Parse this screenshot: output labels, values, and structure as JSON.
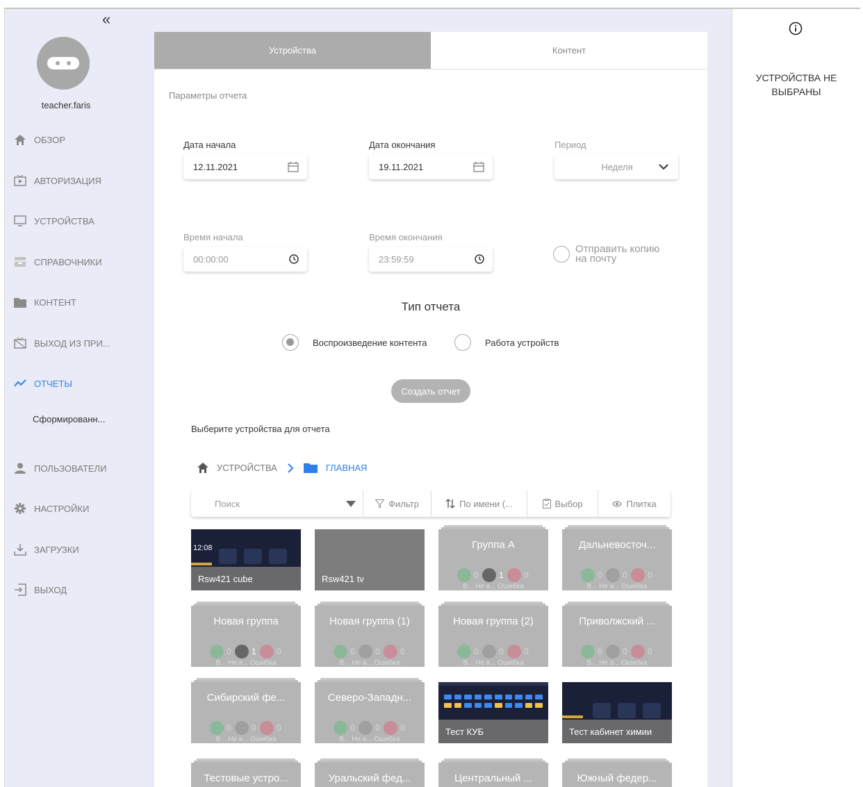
{
  "sidebar": {
    "collapse_glyph": "«",
    "username": "teacher.faris",
    "items": [
      {
        "label": "ОБЗОР",
        "icon": "home-icon"
      },
      {
        "label": "АВТОРИЗАЦИЯ",
        "icon": "tv-play-icon"
      },
      {
        "label": "УСТРОЙСТВА",
        "icon": "monitor-icon"
      },
      {
        "label": "СПРАВОЧНИКИ",
        "icon": "drawer-icon"
      },
      {
        "label": "КОНТЕНТ",
        "icon": "folder-icon"
      },
      {
        "label": "ВЫХОД ИЗ ПРИ...",
        "icon": "tv-off-icon"
      },
      {
        "label": "ОТЧЕТЫ",
        "icon": "chart-line-icon",
        "active": true
      },
      {
        "label": "ПОЛЬЗОВАТЕЛИ",
        "icon": "user-icon"
      },
      {
        "label": "НАСТРОЙКИ",
        "icon": "gear-icon"
      },
      {
        "label": "ЗАГРУЗКИ",
        "icon": "download-icon"
      },
      {
        "label": "ВЫХОД",
        "icon": "logout-icon"
      }
    ],
    "sub_item": "Сформированн..."
  },
  "tabs": [
    {
      "label": "Устройства",
      "active": true
    },
    {
      "label": "Контент",
      "active": false
    }
  ],
  "params_title": "Параметры отчета",
  "form": {
    "start_date_label": "Дата начала",
    "start_date_value": "12.11.2021",
    "end_date_label": "Дата окончания",
    "end_date_value": "19.11.2021",
    "period_label": "Период",
    "period_value": "Неделя",
    "start_time_label": "Время начала",
    "start_time_value": "00:00:00",
    "end_time_label": "Время окончания",
    "end_time_value": "23:59:59",
    "send_copy_line1": "Отправить копию",
    "send_copy_line2": "на почту"
  },
  "report_type": {
    "title": "Тип отчета",
    "options": [
      {
        "label": "Воспроизведение контента",
        "checked": true
      },
      {
        "label": "Работа устройств",
        "checked": false
      }
    ]
  },
  "create_button": "Создать отчет",
  "choose_devices_title": "Выберите устройства для отчета",
  "breadcrumb": {
    "root": "УСТРОЙСТВА",
    "current": "ГЛАВНАЯ"
  },
  "toolbar": {
    "search_placeholder": "Поиск",
    "filter": "Фильтр",
    "sort": "По имени (...",
    "select": "Выбор",
    "view": "Плитка"
  },
  "tiles": [
    {
      "type": "device",
      "name": "Rsw421 cube",
      "clock": "12:08"
    },
    {
      "type": "device",
      "name": "Rsw421 tv"
    },
    {
      "type": "group",
      "name": "Группа А",
      "counts": [
        "0",
        "1",
        "0"
      ],
      "sub": "В... Не в... Ошибка"
    },
    {
      "type": "group",
      "name": "Дальневосточ...",
      "counts": [
        "0",
        "0",
        "0"
      ],
      "sub": "В... Не в... Ошибка"
    },
    {
      "type": "group",
      "name": "Новая группа",
      "counts": [
        "0",
        "1",
        "0"
      ],
      "sub": "В... Не в... Ошибка"
    },
    {
      "type": "group",
      "name": "Новая группа (1)",
      "counts": [
        "0",
        "0",
        "0"
      ],
      "sub": "В... Не в... Ошибка"
    },
    {
      "type": "group",
      "name": "Новая группа (2)",
      "counts": [
        "0",
        "0",
        "0"
      ],
      "sub": "В... Не в... Ошибка"
    },
    {
      "type": "group",
      "name": "Приволжский ...",
      "counts": [
        "0",
        "0",
        "0"
      ],
      "sub": "В... Не в... Ошибка"
    },
    {
      "type": "group",
      "name": "Сибирский фе...",
      "counts": [
        "0",
        "0",
        "0"
      ],
      "sub": "В... Не в... Ошибка"
    },
    {
      "type": "group",
      "name": "Северо-Западн...",
      "counts": [
        "0",
        "0",
        "0"
      ],
      "sub": "В... Не в... Ошибка"
    },
    {
      "type": "device",
      "name": "Тест КУБ"
    },
    {
      "type": "device",
      "name": "Тест кабинет химии"
    },
    {
      "type": "group",
      "name": "Тестовые устро..."
    },
    {
      "type": "group",
      "name": "Уральский фед..."
    },
    {
      "type": "group",
      "name": "Центральный ..."
    },
    {
      "type": "group",
      "name": "Южный федер..."
    }
  ],
  "right_panel": {
    "line1": "УСТРОЙСТВА НЕ",
    "line2": "ВЫБРАНЫ",
    "icon": "info-icon"
  },
  "colors": {
    "accent": "#2f80ed",
    "sidebar_bg": "#e9ecf6",
    "tab_active": "#acacac",
    "tile_group": "#b5b5b5"
  }
}
